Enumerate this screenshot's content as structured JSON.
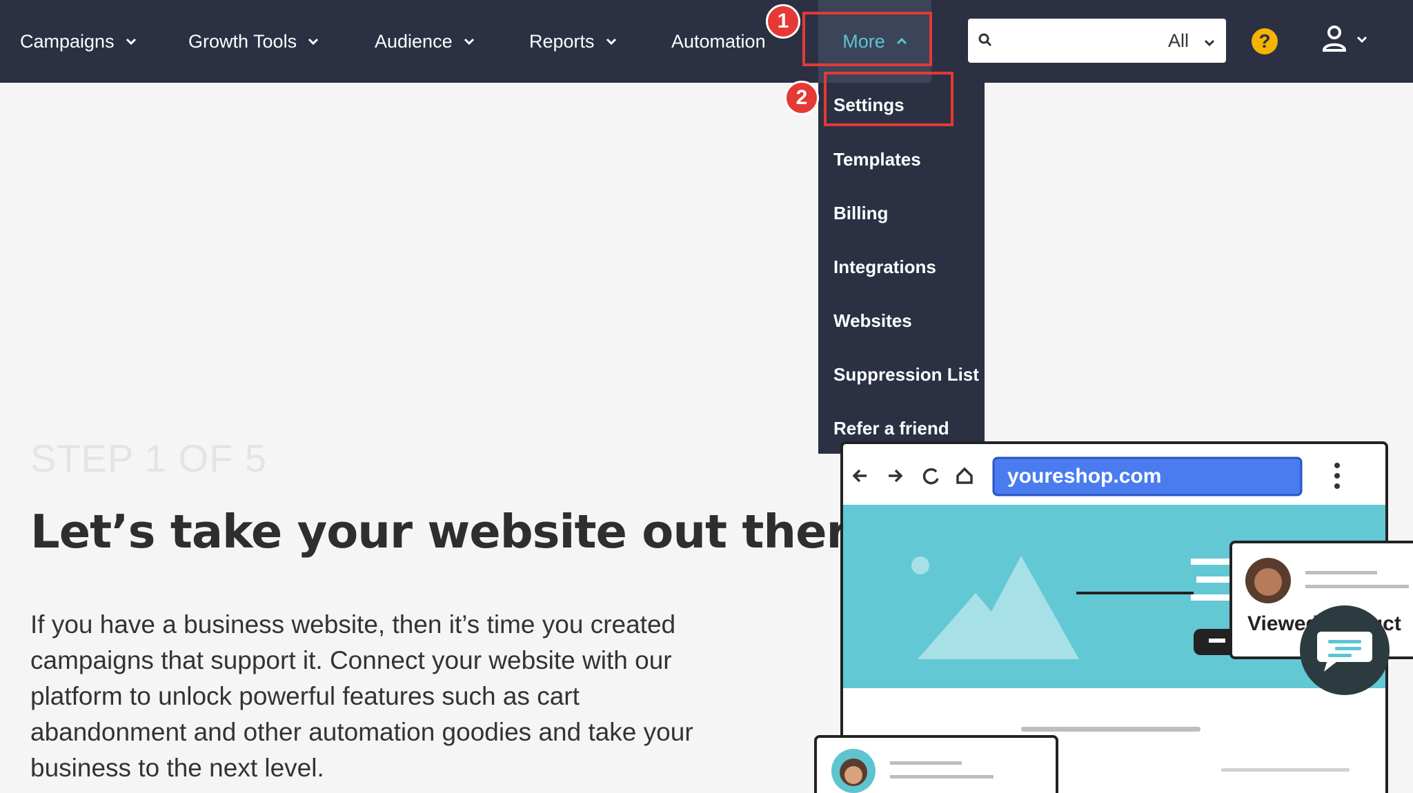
{
  "nav": {
    "items": [
      {
        "label": "Campaigns"
      },
      {
        "label": "Growth Tools"
      },
      {
        "label": "Audience"
      },
      {
        "label": "Reports"
      },
      {
        "label": "Automation"
      },
      {
        "label": "More"
      }
    ],
    "search": {
      "placeholder": "",
      "scope": "All"
    },
    "help_label": "?"
  },
  "annotations": {
    "badge1": "1",
    "badge2": "2"
  },
  "dropdown": {
    "items": [
      {
        "label": "Settings"
      },
      {
        "label": "Templates"
      },
      {
        "label": "Billing"
      },
      {
        "label": "Integrations"
      },
      {
        "label": "Websites"
      },
      {
        "label": "Suppression List"
      },
      {
        "label": "Refer a friend"
      }
    ]
  },
  "main": {
    "step": "STEP 1 OF 5",
    "headline": "Let’s take your website out there",
    "body": "If you have a business website, then it’s time you created campaigns that support it. Connect your website with our platform to unlock powerful features such as cart abandonment and other automation goodies and take your business to the next level."
  },
  "illustration": {
    "url": "youreshop.com",
    "card_text": "Viewed product"
  },
  "colors": {
    "nav_bg": "#2b3143",
    "accent": "#5cc5d4",
    "annotation": "#e53935",
    "help": "#f4b400"
  }
}
